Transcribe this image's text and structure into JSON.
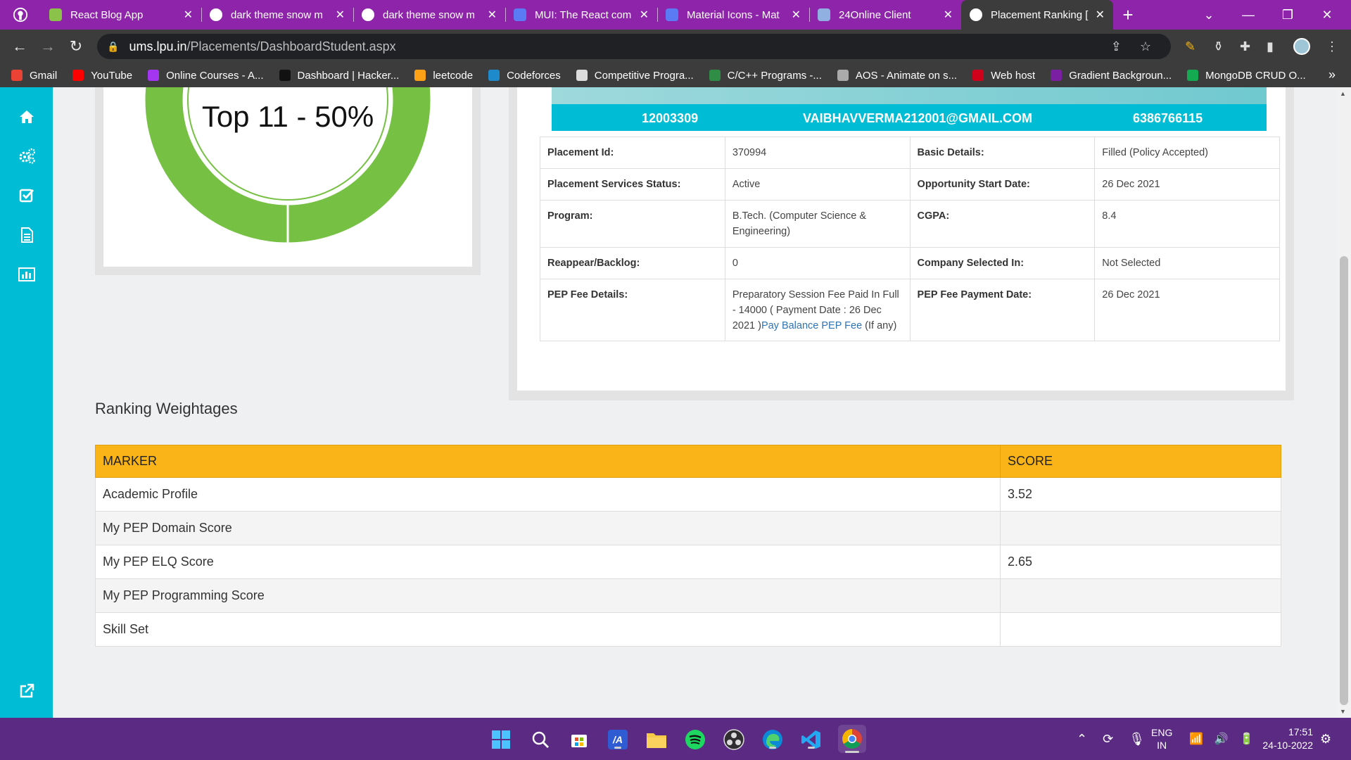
{
  "browser": {
    "tabs": [
      {
        "title": "React Blog App",
        "icon": "react-blog-favicon"
      },
      {
        "title": "dark theme snow m",
        "icon": "google-icon"
      },
      {
        "title": "dark theme snow m",
        "icon": "google-icon"
      },
      {
        "title": "MUI: The React com",
        "icon": "mui-icon"
      },
      {
        "title": "Material Icons - Mat",
        "icon": "mui-icon"
      },
      {
        "title": "24Online Client",
        "icon": "wifi-icon"
      },
      {
        "title": "Placement Ranking [",
        "icon": "globe-icon",
        "active": true
      }
    ],
    "url_host": "ums.lpu.in",
    "url_path": "/Placements/DashboardStudent.aspx",
    "bookmarks": [
      {
        "label": "Gmail",
        "icon": "gmail-icon",
        "color": "#ea4335"
      },
      {
        "label": "YouTube",
        "icon": "youtube-icon",
        "color": "#ff0000"
      },
      {
        "label": "Online Courses - A...",
        "icon": "udemy-icon",
        "color": "#a435f0"
      },
      {
        "label": "Dashboard | Hacker...",
        "icon": "hackerrank-icon",
        "color": "#111111"
      },
      {
        "label": "leetcode",
        "icon": "leetcode-icon",
        "color": "#ffa116"
      },
      {
        "label": "Codeforces",
        "icon": "codeforces-icon",
        "color": "#1f8acb"
      },
      {
        "label": "Competitive Progra...",
        "icon": "cc-icon",
        "color": "#dddddd"
      },
      {
        "label": "C/C++ Programs -...",
        "icon": "gfg-icon",
        "color": "#2f8d46"
      },
      {
        "label": "AOS - Animate on s...",
        "icon": "globe-icon",
        "color": "#aaaaaa"
      },
      {
        "label": "Web host",
        "icon": "webhost-icon",
        "color": "#d0021b"
      },
      {
        "label": "Gradient Backgroun...",
        "icon": "gradient-icon",
        "color": "#7b1fa2"
      },
      {
        "label": "MongoDB CRUD O...",
        "icon": "mongodb-icon",
        "color": "#13aa52"
      }
    ]
  },
  "ranking": {
    "donut_label": "Top 11 - 50%",
    "donut_fraction": 0.5
  },
  "student": {
    "reg_no": "12003309",
    "email": "VAIBHAVVERMA212001@GMAIL.COM",
    "phone": "6386766115"
  },
  "details": {
    "placement_id_label": "Placement Id:",
    "placement_id": "370994",
    "basic_details_label": "Basic Details:",
    "basic_details": "Filled (Policy Accepted)",
    "status_label": "Placement Services Status:",
    "status": "Active",
    "opp_start_label": "Opportunity Start Date:",
    "opp_start": "26 Dec 2021",
    "program_label": "Program:",
    "program": "B.Tech. (Computer Science & Engineering)",
    "cgpa_label": "CGPA:",
    "cgpa": "8.4",
    "backlog_label": "Reappear/Backlog:",
    "backlog": "0",
    "company_label": "Company Selected In:",
    "company": "Not Selected",
    "pep_fee_label": "PEP Fee Details:",
    "pep_fee": "Preparatory Session Fee Paid In Full - 14000 ( Payment Date : 26 Dec 2021 )",
    "pep_fee_link": "Pay Balance PEP Fee",
    "pep_fee_suffix": " (If any)",
    "pep_pay_date_label": "PEP Fee Payment Date:",
    "pep_pay_date": "26 Dec 2021"
  },
  "weightages": {
    "title": "Ranking Weightages",
    "header_marker": "MARKER",
    "header_score": "SCORE",
    "rows": [
      {
        "marker": "Academic Profile",
        "score": "3.52"
      },
      {
        "marker": "My PEP Domain Score",
        "score": ""
      },
      {
        "marker": "My PEP ELQ Score",
        "score": "2.65"
      },
      {
        "marker": "My PEP Programming Score",
        "score": ""
      },
      {
        "marker": "Skill Set",
        "score": ""
      }
    ]
  },
  "taskbar": {
    "language": "ENG",
    "region": "IN",
    "time": "17:51",
    "date": "24-10-2022"
  },
  "colors": {
    "sidebar": "#00bcd4",
    "table_header": "#fbb417",
    "donut_green": "#76c043",
    "browser_frame": "#8e24aa"
  }
}
